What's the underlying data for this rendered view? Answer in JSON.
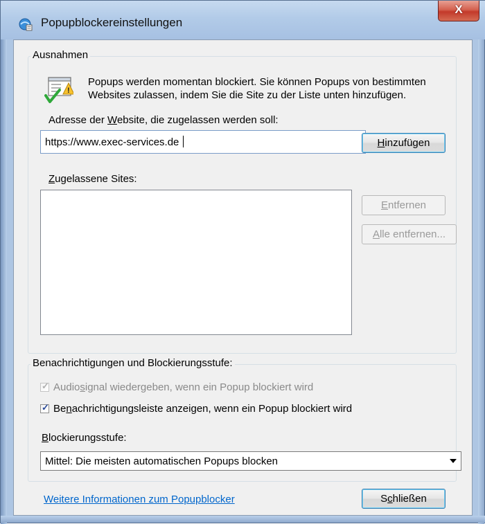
{
  "window": {
    "title": "Popupblockereinstellungen",
    "close_label": "X"
  },
  "exceptions": {
    "legend": "Ausnahmen",
    "info_line1": "Popups werden momentan blockiert. Sie können Popups von bestimmten",
    "info_line2": "Websites zulassen, indem Sie die Site zu der Liste unten hinzufügen.",
    "address_label_pre": "Adresse der ",
    "address_label_u": "W",
    "address_label_post": "ebsite, die zugelassen werden soll:",
    "address_value": "https://www.exec-services.de",
    "add_pre": "",
    "add_u": "H",
    "add_post": "inzufügen",
    "allowed_label_u": "Z",
    "allowed_label_post": "ugelassene Sites:",
    "allowed_sites": [],
    "remove_pre": "",
    "remove_u": "E",
    "remove_post": "ntfernen",
    "remove_all_pre": "",
    "remove_all_u": "A",
    "remove_all_post": "lle entfernen..."
  },
  "notifications": {
    "legend": "Benachrichtigungen und Blockierungsstufe:",
    "audio_pre": "Audio",
    "audio_u": "s",
    "audio_post": "ignal wiedergeben, wenn ein Popup blockiert wird",
    "audio_checked": true,
    "bar_pre": "Be",
    "bar_u": "n",
    "bar_post": "achrichtigungsleiste anzeigen, wenn ein Popup blockiert wird",
    "bar_checked": true,
    "level_label_u": "B",
    "level_label_post": "lockierungsstufe:",
    "level_value": "Mittel: Die meisten automatischen Popups blocken"
  },
  "footer": {
    "link": "Weitere Informationen zum Popupblocker",
    "close_pre": "S",
    "close_u": "c",
    "close_post": "hließen"
  },
  "colors": {
    "link": "#0066cc",
    "titlebar": "#b2cbe8",
    "close_button": "#c3392a"
  }
}
